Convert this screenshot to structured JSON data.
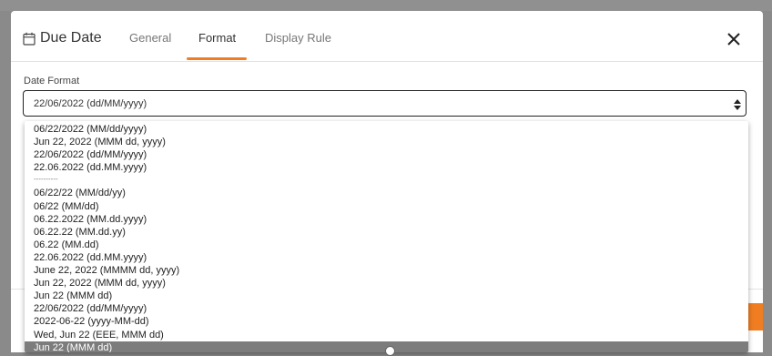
{
  "dialog": {
    "title": "Due Date",
    "title_icon": "calendar-icon",
    "close_icon": "close-icon",
    "tabs": [
      {
        "label": "General",
        "active": false
      },
      {
        "label": "Format",
        "active": true
      },
      {
        "label": "Display Rule",
        "active": false
      }
    ],
    "accent_color": "#f07d22"
  },
  "date_format": {
    "label": "Date Format",
    "value": "22/06/2022 (dd/MM/yyyy)",
    "options": [
      "06/22/2022 (MM/dd/yyyy)",
      "Jun 22, 2022 (MMM dd, yyyy)",
      "22/06/2022 (dd/MM/yyyy)",
      "22.06.2022 (dd.MM.yyyy)",
      "----------",
      "06/22/22 (MM/dd/yy)",
      "06/22 (MM/dd)",
      "06.22.2022 (MM.dd.yyyy)",
      "06.22.22 (MM.dd.yy)",
      "06.22 (MM.dd)",
      "22.06.2022 (dd.MM.yyyy)",
      "June 22, 2022 (MMMM dd, yyyy)",
      "Jun 22, 2022 (MMM dd, yyyy)",
      "Jun 22 (MMM dd)",
      "22/06/2022 (dd/MM/yyyy)",
      "2022-06-22 (yyyy-MM-dd)",
      "Wed, Jun 22 (EEE, MMM dd)",
      "Jun 22 (MMM dd)"
    ],
    "highlighted_option": "Jun 22 (MMM dd)"
  }
}
